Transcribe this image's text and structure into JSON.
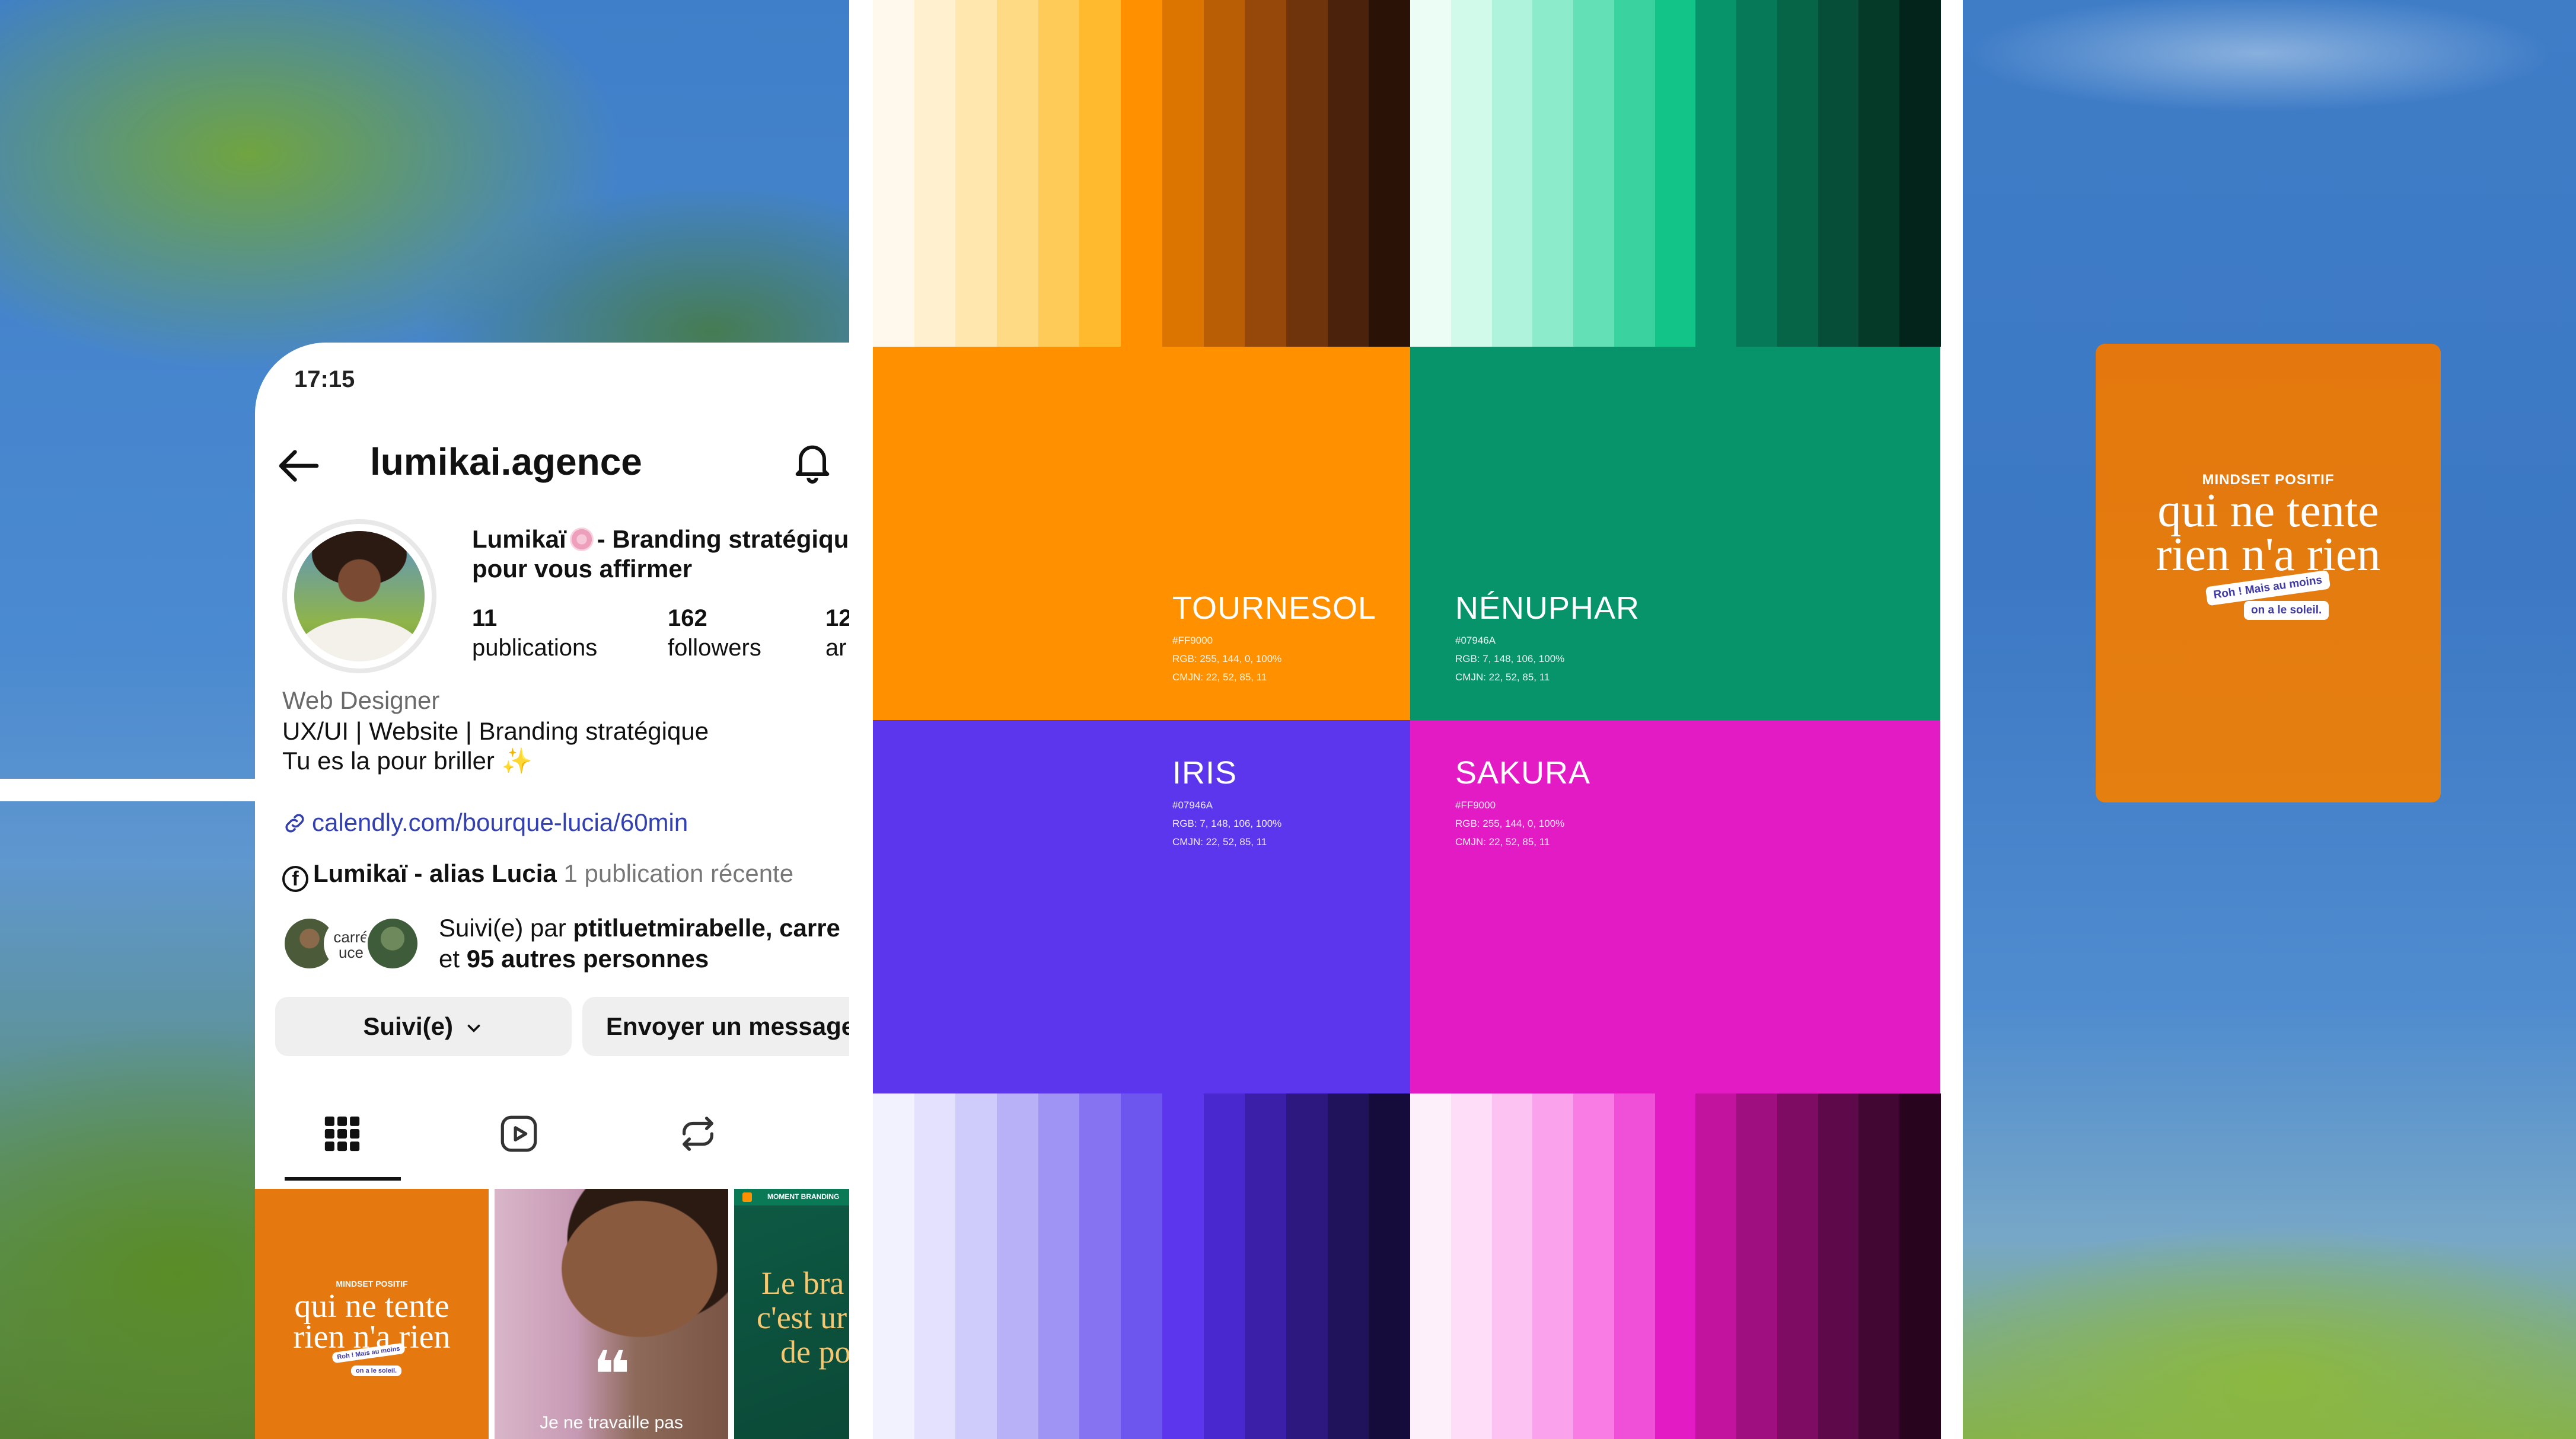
{
  "status_bar": {
    "time": "17:15"
  },
  "profile": {
    "username": "lumikai.agence",
    "bio_name": "Lumikaï",
    "bio_name_suffix": "- Branding stratégique",
    "bio_name_line2": "pour vous affirmer",
    "stats": [
      {
        "value": "11",
        "label": "publications"
      },
      {
        "value": "162",
        "label": "followers"
      },
      {
        "value": "12",
        "label": "ar"
      }
    ],
    "category": "Web Designer",
    "bio_line1": "UX/UI | Website | Branding stratégique",
    "bio_line2": "Tu es la pour briller ✨",
    "link": "calendly.com/bourque-lucia/60min",
    "fb_name": "Lumikaï - alias Lucia",
    "fb_recent": "1 publication récente",
    "mutual_avatar_label": "carré uce",
    "mutual_prefix": "Suivi(e) par",
    "mutual_names": "ptitluetmirabelle, carre",
    "mutual_line2_prefix": "et",
    "mutual_line2_bold": "95 autres personnes",
    "follow_button": "Suivi(e)",
    "message_button": "Envoyer un message",
    "grid": [
      {
        "kicker": "MINDSET POSITIF",
        "title1": "qui ne tente",
        "title2": "rien n'a rien",
        "tag1": "Roh ! Mais au moins",
        "tag2": "on a le soleil."
      },
      {
        "quote": "❝",
        "caption": "Je ne travaille pas"
      },
      {
        "kicker": "MOMENT BRANDING",
        "title1": "Le bra",
        "title2": "c'est ur",
        "title3": "de po"
      }
    ]
  },
  "palette": [
    {
      "name": "TOURNESOL",
      "hex": "#FF9000",
      "rgb": "RGB: 255, 144, 0, 100%",
      "cmjn": "CMJN: 22, 52, 85, 11",
      "color": "#FF9000"
    },
    {
      "name": "NÉNUPHAR",
      "hex": "#07946A",
      "rgb": "RGB: 7, 148, 106, 100%",
      "cmjn": "CMJN: 22, 52, 85, 11",
      "color": "#07946A"
    },
    {
      "name": "IRIS",
      "hex": "#07946A",
      "rgb": "RGB: 7, 148, 106, 100%",
      "cmjn": "CMJN: 22, 52, 85, 11",
      "color": "#5B36EC"
    },
    {
      "name": "SAKURA",
      "hex": "#FF9000",
      "rgb": "RGB: 255, 144, 0, 100%",
      "cmjn": "CMJN: 22, 52, 85, 11",
      "color": "#E21BC4"
    }
  ],
  "strips": {
    "orange": [
      "#FFF8EC",
      "#FFF0D0",
      "#FFE7AE",
      "#FFDA85",
      "#FFCB58",
      "#FFBA2D",
      "#FF9000",
      "#DC7400",
      "#B95E05",
      "#95480A",
      "#6F340C",
      "#4B220B",
      "#2A1207"
    ],
    "green": [
      "#ECFDF6",
      "#D2FAEB",
      "#B0F3DC",
      "#8BEBCB",
      "#64E0B6",
      "#3AD29F",
      "#12C488",
      "#07946A",
      "#067A58",
      "#066447",
      "#064E37",
      "#053A29",
      "#03241A"
    ],
    "purple": [
      "#F2F1FE",
      "#E3E1FD",
      "#CFCBFB",
      "#B8B1F8",
      "#9F93F4",
      "#8573F1",
      "#6C56EE",
      "#5B36EC",
      "#4A28CF",
      "#3B1FA8",
      "#2D1880",
      "#21125C",
      "#160C3C"
    ],
    "pink": [
      "#FEF0FB",
      "#FDDDF7",
      "#FCC2F2",
      "#FBA2EC",
      "#F97CE4",
      "#F04FD7",
      "#E21BC4",
      "#C2139F",
      "#A00F80",
      "#7E0C63",
      "#5E0949",
      "#420733",
      "#29041F"
    ]
  },
  "post": {
    "kicker": "MINDSET POSITIF",
    "title1": "qui ne tente",
    "title2": "rien n'a rien",
    "tag1": "Roh ! Mais au moins",
    "tag2": "on a le soleil."
  }
}
